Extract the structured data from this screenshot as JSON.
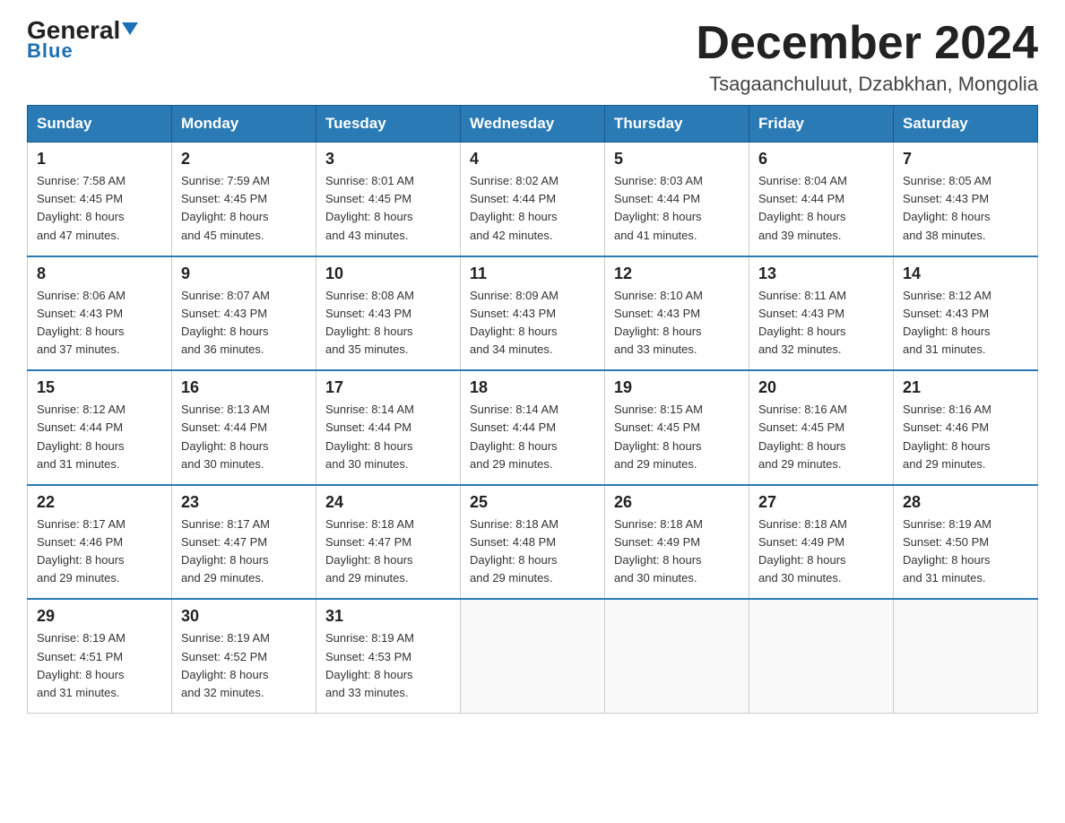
{
  "logo": {
    "general": "General",
    "triangle": "▼",
    "blue": "Blue"
  },
  "title": "December 2024",
  "subtitle": "Tsagaanchuluut, Dzabkhan, Mongolia",
  "days_of_week": [
    "Sunday",
    "Monday",
    "Tuesday",
    "Wednesday",
    "Thursday",
    "Friday",
    "Saturday"
  ],
  "weeks": [
    [
      {
        "day": "1",
        "sunrise": "7:58 AM",
        "sunset": "4:45 PM",
        "daylight": "8 hours and 47 minutes."
      },
      {
        "day": "2",
        "sunrise": "7:59 AM",
        "sunset": "4:45 PM",
        "daylight": "8 hours and 45 minutes."
      },
      {
        "day": "3",
        "sunrise": "8:01 AM",
        "sunset": "4:45 PM",
        "daylight": "8 hours and 43 minutes."
      },
      {
        "day": "4",
        "sunrise": "8:02 AM",
        "sunset": "4:44 PM",
        "daylight": "8 hours and 42 minutes."
      },
      {
        "day": "5",
        "sunrise": "8:03 AM",
        "sunset": "4:44 PM",
        "daylight": "8 hours and 41 minutes."
      },
      {
        "day": "6",
        "sunrise": "8:04 AM",
        "sunset": "4:44 PM",
        "daylight": "8 hours and 39 minutes."
      },
      {
        "day": "7",
        "sunrise": "8:05 AM",
        "sunset": "4:43 PM",
        "daylight": "8 hours and 38 minutes."
      }
    ],
    [
      {
        "day": "8",
        "sunrise": "8:06 AM",
        "sunset": "4:43 PM",
        "daylight": "8 hours and 37 minutes."
      },
      {
        "day": "9",
        "sunrise": "8:07 AM",
        "sunset": "4:43 PM",
        "daylight": "8 hours and 36 minutes."
      },
      {
        "day": "10",
        "sunrise": "8:08 AM",
        "sunset": "4:43 PM",
        "daylight": "8 hours and 35 minutes."
      },
      {
        "day": "11",
        "sunrise": "8:09 AM",
        "sunset": "4:43 PM",
        "daylight": "8 hours and 34 minutes."
      },
      {
        "day": "12",
        "sunrise": "8:10 AM",
        "sunset": "4:43 PM",
        "daylight": "8 hours and 33 minutes."
      },
      {
        "day": "13",
        "sunrise": "8:11 AM",
        "sunset": "4:43 PM",
        "daylight": "8 hours and 32 minutes."
      },
      {
        "day": "14",
        "sunrise": "8:12 AM",
        "sunset": "4:43 PM",
        "daylight": "8 hours and 31 minutes."
      }
    ],
    [
      {
        "day": "15",
        "sunrise": "8:12 AM",
        "sunset": "4:44 PM",
        "daylight": "8 hours and 31 minutes."
      },
      {
        "day": "16",
        "sunrise": "8:13 AM",
        "sunset": "4:44 PM",
        "daylight": "8 hours and 30 minutes."
      },
      {
        "day": "17",
        "sunrise": "8:14 AM",
        "sunset": "4:44 PM",
        "daylight": "8 hours and 30 minutes."
      },
      {
        "day": "18",
        "sunrise": "8:14 AM",
        "sunset": "4:44 PM",
        "daylight": "8 hours and 29 minutes."
      },
      {
        "day": "19",
        "sunrise": "8:15 AM",
        "sunset": "4:45 PM",
        "daylight": "8 hours and 29 minutes."
      },
      {
        "day": "20",
        "sunrise": "8:16 AM",
        "sunset": "4:45 PM",
        "daylight": "8 hours and 29 minutes."
      },
      {
        "day": "21",
        "sunrise": "8:16 AM",
        "sunset": "4:46 PM",
        "daylight": "8 hours and 29 minutes."
      }
    ],
    [
      {
        "day": "22",
        "sunrise": "8:17 AM",
        "sunset": "4:46 PM",
        "daylight": "8 hours and 29 minutes."
      },
      {
        "day": "23",
        "sunrise": "8:17 AM",
        "sunset": "4:47 PM",
        "daylight": "8 hours and 29 minutes."
      },
      {
        "day": "24",
        "sunrise": "8:18 AM",
        "sunset": "4:47 PM",
        "daylight": "8 hours and 29 minutes."
      },
      {
        "day": "25",
        "sunrise": "8:18 AM",
        "sunset": "4:48 PM",
        "daylight": "8 hours and 29 minutes."
      },
      {
        "day": "26",
        "sunrise": "8:18 AM",
        "sunset": "4:49 PM",
        "daylight": "8 hours and 30 minutes."
      },
      {
        "day": "27",
        "sunrise": "8:18 AM",
        "sunset": "4:49 PM",
        "daylight": "8 hours and 30 minutes."
      },
      {
        "day": "28",
        "sunrise": "8:19 AM",
        "sunset": "4:50 PM",
        "daylight": "8 hours and 31 minutes."
      }
    ],
    [
      {
        "day": "29",
        "sunrise": "8:19 AM",
        "sunset": "4:51 PM",
        "daylight": "8 hours and 31 minutes."
      },
      {
        "day": "30",
        "sunrise": "8:19 AM",
        "sunset": "4:52 PM",
        "daylight": "8 hours and 32 minutes."
      },
      {
        "day": "31",
        "sunrise": "8:19 AM",
        "sunset": "4:53 PM",
        "daylight": "8 hours and 33 minutes."
      },
      null,
      null,
      null,
      null
    ]
  ],
  "labels": {
    "sunrise": "Sunrise:",
    "sunset": "Sunset:",
    "daylight": "Daylight:"
  }
}
